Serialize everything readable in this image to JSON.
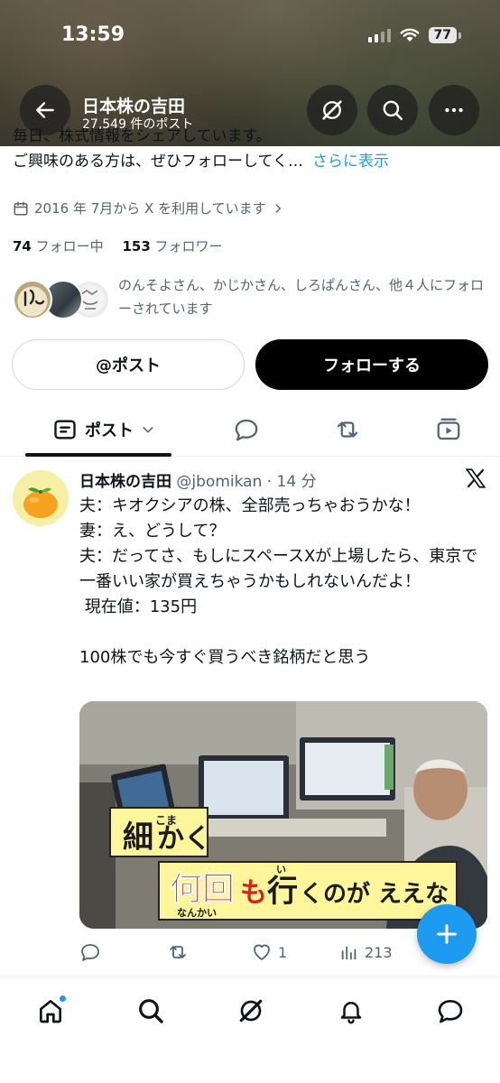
{
  "status_bar": {
    "time": "13:59",
    "battery": "77"
  },
  "header": {
    "title": "日本株の吉田",
    "subtitle": "27,549 件のポスト"
  },
  "bio": {
    "line1": "毎日、株式情報をシェアしています。",
    "line2": "ご興味のある方は、ぜひフォローしてく…",
    "more": "さらに表示"
  },
  "joined": "2016 年 7月から X を利用しています",
  "counts": {
    "following_num": "74",
    "following_label": "フォロー中",
    "followers_num": "153",
    "followers_label": "フォロワー"
  },
  "followed_by": "のんそよさん、かじかさん、しろぱんさん、他４人にフォローされています",
  "buttons": {
    "post": "@ポスト",
    "follow": "フォローする"
  },
  "tabs": [
    {
      "label": "ポスト"
    }
  ],
  "tweet": {
    "name": "日本株の吉田",
    "meta": "@jbomikan · 14 分",
    "body": "夫：キオクシアの株、全部売っちゃおうかな！\n妻：え、どうして？\n夫：だってさ、もしにスペースXが上場したら、東京で一番いい家が買えちゃうかもしれないんだよ！\n 現在値：135円\n\n100株でも今すぐ買うべき銘柄だと思う",
    "media_caption": {
      "line1_a": "細",
      "line1_b": "かく",
      "ruby1": "こま",
      "line2_a": "何回",
      "line2_b": "も",
      "line2_c": "行",
      "line2_d": "くのが ええな",
      "ruby2a": "なんかい",
      "ruby2b": "い"
    },
    "likes": "1",
    "views": "213"
  },
  "colors": {
    "accent": "#1d9bf0",
    "text": "#0f1419",
    "muted": "#536471"
  }
}
